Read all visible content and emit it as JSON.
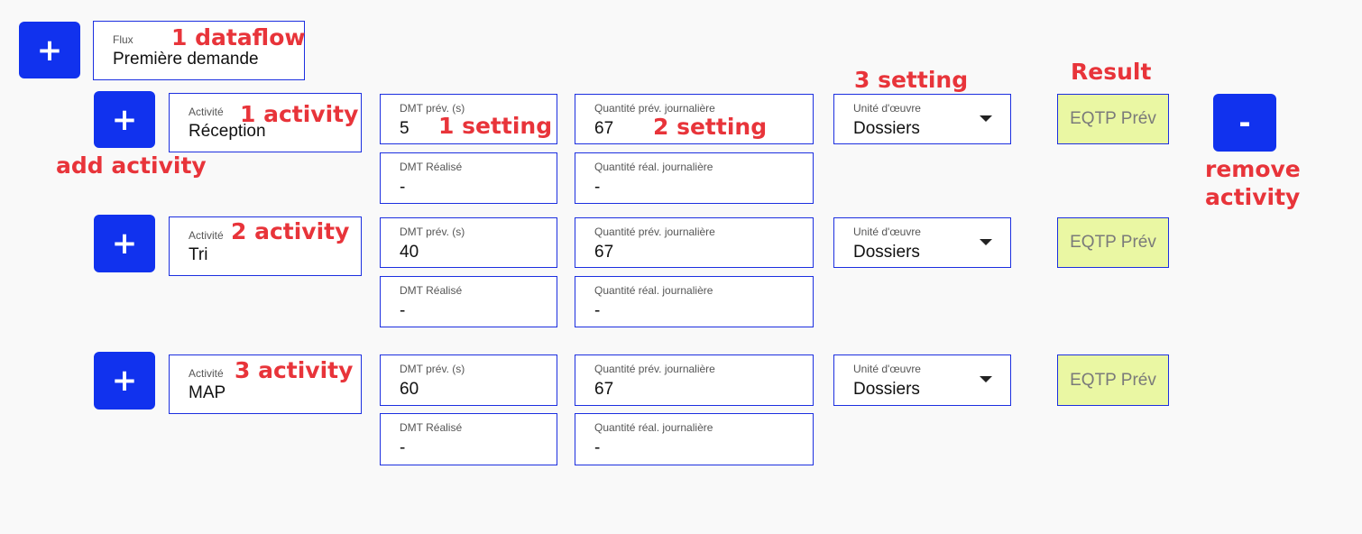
{
  "flow": {
    "add_label": "+",
    "label": "Flux",
    "value": "Première demande"
  },
  "activities": [
    {
      "add_label": "+",
      "activity_label": "Activité",
      "activity_value": "Réception",
      "dmt_prev_label": "DMT prév. (s)",
      "dmt_prev_value": "5",
      "dmt_real_label": "DMT Réalisé",
      "dmt_real_value": "-",
      "qty_prev_label": "Quantité prév. journalière",
      "qty_prev_value": "67",
      "qty_real_label": "Quantité réal. journalière",
      "qty_real_value": "-",
      "unit_label": "Unité d'œuvre",
      "unit_value": "Dossiers",
      "result_label": "EQTP Prév"
    },
    {
      "add_label": "+",
      "activity_label": "Activité",
      "activity_value": "Tri",
      "dmt_prev_label": "DMT prév. (s)",
      "dmt_prev_value": "40",
      "dmt_real_label": "DMT Réalisé",
      "dmt_real_value": "-",
      "qty_prev_label": "Quantité prév. journalière",
      "qty_prev_value": "67",
      "qty_real_label": "Quantité réal. journalière",
      "qty_real_value": "-",
      "unit_label": "Unité d'œuvre",
      "unit_value": "Dossiers",
      "result_label": "EQTP Prév"
    },
    {
      "add_label": "+",
      "activity_label": "Activité",
      "activity_value": "MAP",
      "dmt_prev_label": "DMT prév. (s)",
      "dmt_prev_value": "60",
      "dmt_real_label": "DMT Réalisé",
      "dmt_real_value": "-",
      "qty_prev_label": "Quantité prév. journalière",
      "qty_prev_value": "67",
      "qty_real_label": "Quantité réal. journalière",
      "qty_real_value": "-",
      "unit_label": "Unité d'œuvre",
      "unit_value": "Dossiers",
      "result_label": "EQTP Prév"
    }
  ],
  "remove_button_label": "-",
  "annotations": {
    "dataflow": "1 dataflow",
    "activity_1": "1 activity",
    "activity_2": "2 activity",
    "activity_3": "3 activity",
    "setting_1": "1 setting",
    "setting_2": "2 setting",
    "setting_3": "3 setting",
    "result": "Result",
    "add_activity": "add activity",
    "remove_activity_line1": "remove",
    "remove_activity_line2": "activity"
  },
  "colors": {
    "button": "#1132ee",
    "field_border": "#1c2fe0",
    "result_bg": "#eaf7a3",
    "annotation": "#e8343a"
  }
}
